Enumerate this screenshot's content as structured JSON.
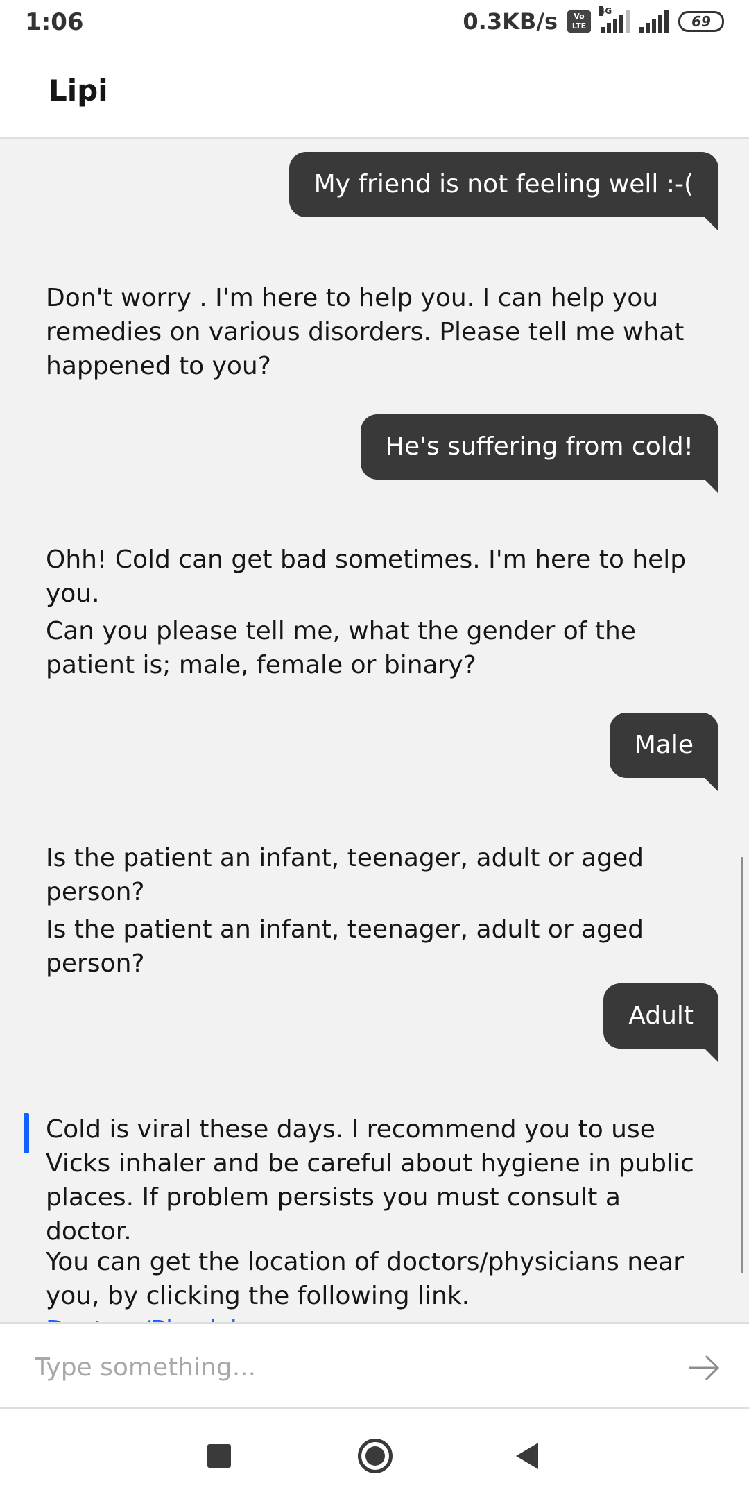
{
  "status_bar": {
    "time": "1:06",
    "network_speed": "0.3KB/s",
    "volte": "Vo\nLTE",
    "network_type": "4G",
    "battery": "69"
  },
  "header": {
    "title": "Lipi"
  },
  "messages": {
    "m1": "My friend is not feeling well :-(",
    "m2": "Don't worry . I'm here to help you. I can help you remedies on various disorders. Please tell me what happened to you?",
    "m3": "He's suffering from cold!",
    "m4": "Ohh! Cold can get bad sometimes. I'm here to help you.",
    "m5": "Can you please tell me, what the gender of the patient is; male, female or binary?",
    "m6": "Male",
    "m7": "Is the patient an infant, teenager, adult or aged person?",
    "m8": "Is the patient an infant, teenager, adult or aged person?",
    "m9": "Adult",
    "m10": "Cold is viral these days. I recommend you to use Vicks inhaler and be careful about hygiene in public places. If problem persists you must consult a doctor.",
    "m11_text": "You can get the location of doctors/physicians near you, by clicking the following link.",
    "m11_link": "Doctors/Physicians"
  },
  "composer": {
    "placeholder": "Type something...",
    "send_icon": "arrow-right-icon"
  },
  "nav": {
    "recent": "square-icon",
    "home": "circle-icon",
    "back": "triangle-back-icon"
  },
  "colors": {
    "user_bubble": "#393939",
    "chat_bg": "#f2f2f2",
    "link": "#0f62fe",
    "accent_bar": "#0f62fe"
  }
}
